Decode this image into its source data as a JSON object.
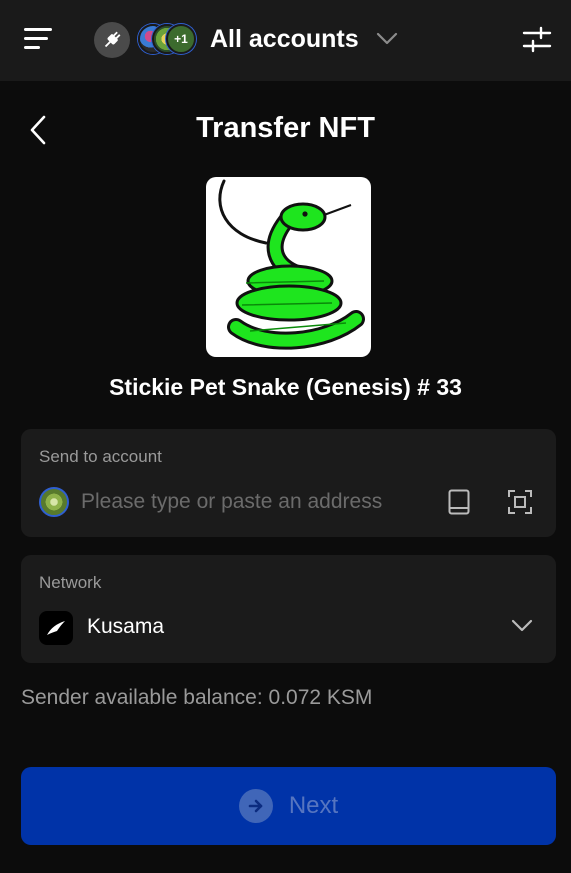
{
  "header": {
    "accounts_label": "All accounts",
    "avatars_extra_count": "+1",
    "icons": {
      "menu": "hamburger-menu-icon",
      "connection": "plug-icon",
      "dropdown": "chevron-down-icon",
      "settings": "sliders-icon"
    }
  },
  "page": {
    "title": "Transfer NFT",
    "back_icon": "chevron-left-icon"
  },
  "nft": {
    "name": "Stickie Pet Snake (Genesis) # 33",
    "image_description": "green-snake-drawing"
  },
  "send_to": {
    "label": "Send to account",
    "placeholder": "Please type or paste an address",
    "value": "",
    "icons": {
      "address_book": "book-icon",
      "scan": "scan-qr-icon"
    }
  },
  "network": {
    "label": "Network",
    "value": "Kusama",
    "icon": "kusama-logo-icon"
  },
  "balance": {
    "text": "Sender available balance: 0.072 KSM"
  },
  "actions": {
    "next_label": "Next",
    "next_icon": "arrow-right-circle-icon"
  },
  "colors": {
    "background": "#0c0c0c",
    "topbar": "#1a1a1a",
    "card": "#1b1b1b",
    "primary_disabled": "#0033a8",
    "snake_green": "#1ee51e",
    "muted_text": "#9a9a9a",
    "placeholder_text": "#6b6b6b"
  }
}
